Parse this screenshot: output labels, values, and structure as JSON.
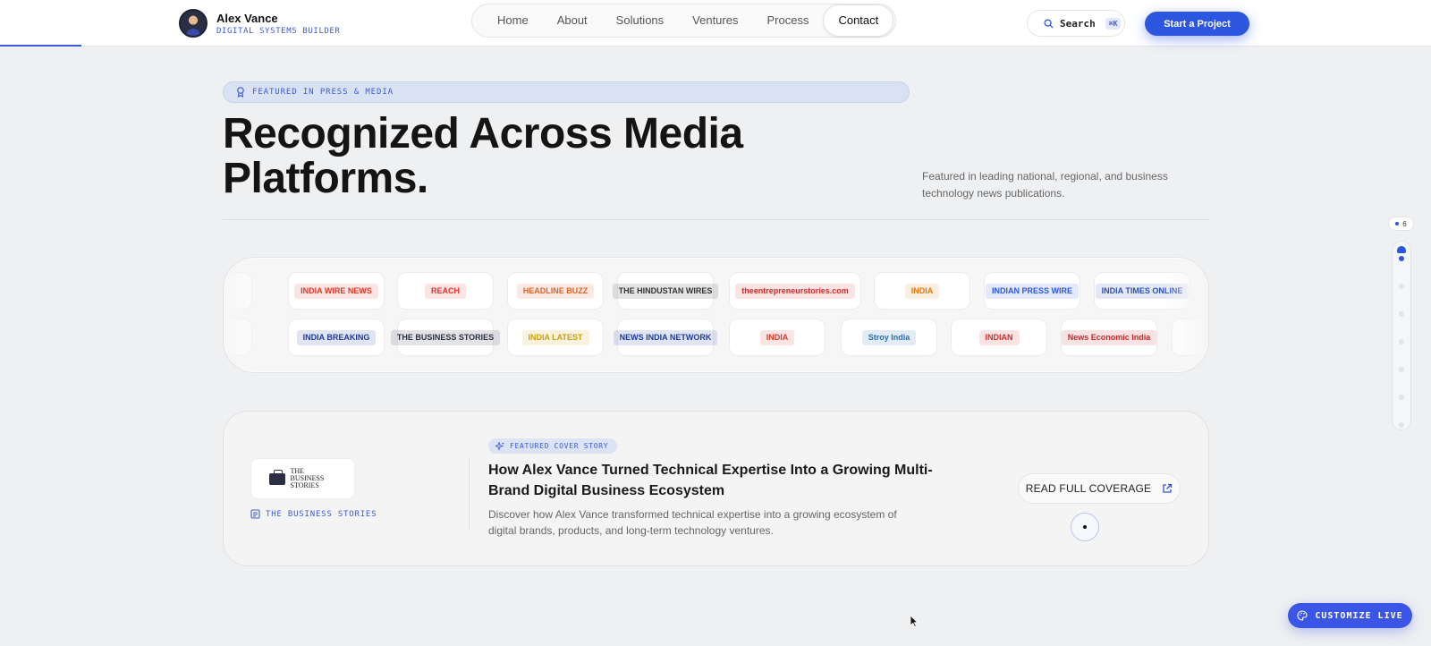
{
  "header": {
    "name": "Alex Vance",
    "tagline": "DIGITAL SYSTEMS BUILDER",
    "nav": [
      "Home",
      "About",
      "Solutions",
      "Ventures",
      "Process",
      "Contact"
    ],
    "active_nav": "Contact",
    "search_label": "Search",
    "search_shortcut": "⌘K",
    "cta_label": "Start a Project"
  },
  "hero": {
    "badge": "FEATURED IN PRESS & MEDIA",
    "title_line1": "Recognized Across Media",
    "title_line2": "Platforms.",
    "subtitle": "Featured in leading national, regional, and business technology news publications."
  },
  "logos": {
    "row1": [
      {
        "text": "",
        "color": "#e94b35"
      },
      {
        "text": "INDIA WIRE NEWS",
        "color": "#d83a2c"
      },
      {
        "text": "REACH",
        "color": "#e0322a"
      },
      {
        "text": "HEADLINE BUZZ",
        "color": "#e0632a"
      },
      {
        "text": "THE HINDUSTAN WIRES",
        "color": "#333333"
      },
      {
        "text": "theentrepreneurstories.com",
        "color": "#d42a2a"
      },
      {
        "text": "INDIA",
        "color": "#e07a12"
      },
      {
        "text": "INDIAN PRESS WIRE",
        "color": "#2d56e0"
      },
      {
        "text": "INDIA TIMES ONLINE",
        "color": "#2d4fb0"
      }
    ],
    "row2": [
      {
        "text": "",
        "color": "#e94b35"
      },
      {
        "text": "INDIA BREAKING",
        "color": "#1f3a9a"
      },
      {
        "text": "THE BUSINESS STORIES",
        "color": "#2a2f45"
      },
      {
        "text": "INDIA LATEST",
        "color": "#c9a012"
      },
      {
        "text": "NEWS INDIA NETWORK",
        "color": "#1f3a9a"
      },
      {
        "text": "INDIA",
        "color": "#d83a2c"
      },
      {
        "text": "Stroy India",
        "color": "#2a6db0"
      },
      {
        "text": "INDIAN",
        "color": "#d42a2a"
      },
      {
        "text": "News Economic India",
        "color": "#c42a2a"
      },
      {
        "text": "",
        "color": "#cccccc"
      }
    ]
  },
  "feature": {
    "publication": "THE BUSINESS STORIES",
    "logo_text": "THE BUSINESS STORIES",
    "badge": "FEATURED COVER STORY",
    "title": "How Alex Vance Turned Technical Expertise Into a Growing Multi-Brand Digital Business Ecosystem",
    "description": "Discover how Alex Vance transformed technical expertise into a growing ecosystem of digital brands, products, and long-term technology ventures.",
    "read_label": "READ FULL COVERAGE"
  },
  "rail": {
    "count": "6",
    "active_index": 0,
    "dot_count": 7
  },
  "customize_label": "CUSTOMIZE LIVE",
  "colors": {
    "accent": "#2d56e0",
    "background": "#eff0f2"
  }
}
